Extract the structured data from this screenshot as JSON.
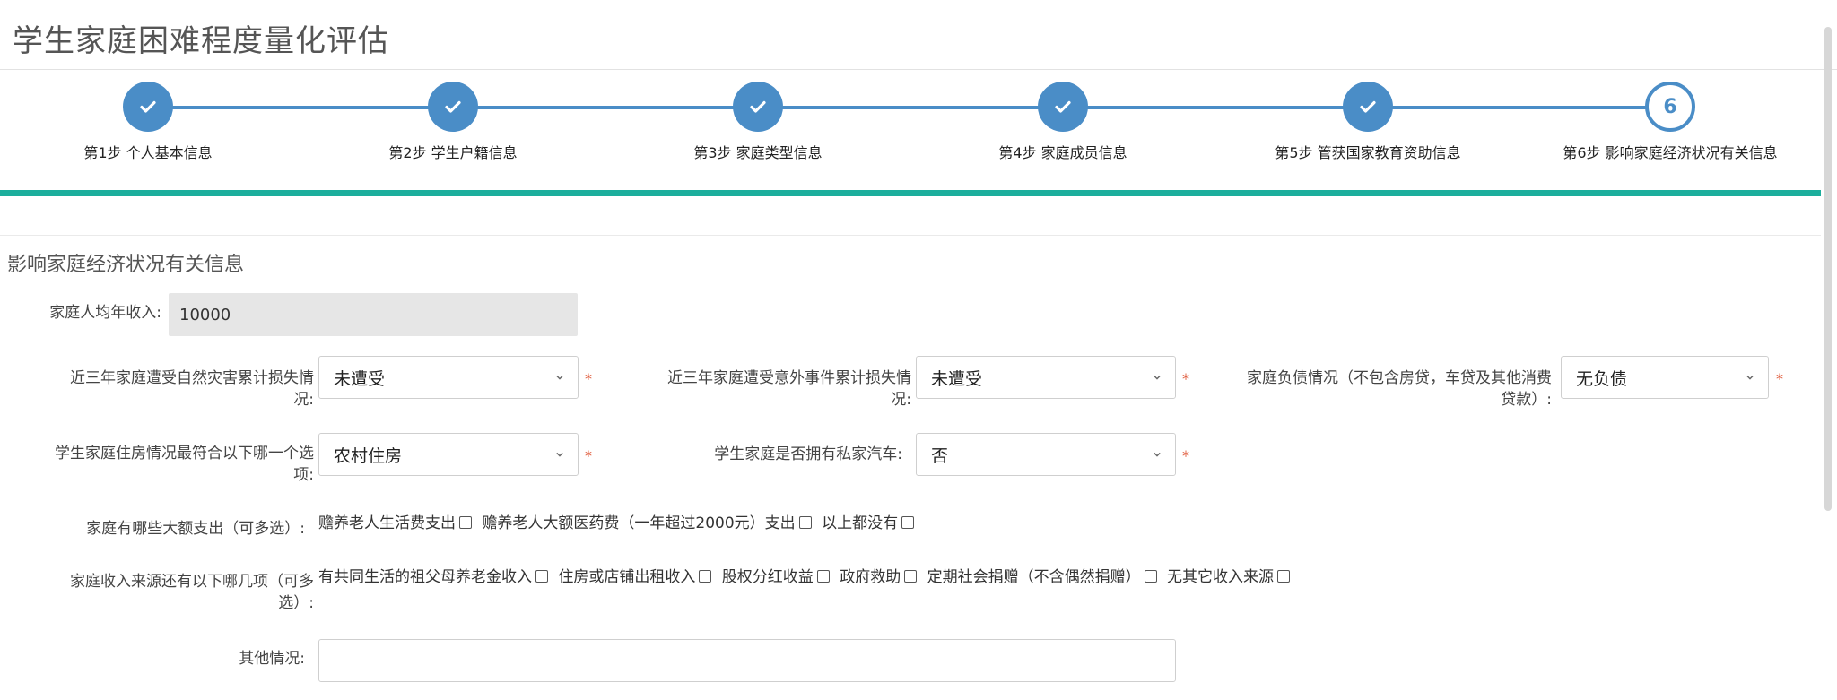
{
  "page": {
    "title": "学生家庭困难程度量化评估"
  },
  "steps": [
    {
      "label": "第1步 个人基本信息",
      "status": "done"
    },
    {
      "label": "第2步 学生户籍信息",
      "status": "done"
    },
    {
      "label": "第3步 家庭类型信息",
      "status": "done"
    },
    {
      "label": "第4步 家庭成员信息",
      "status": "done"
    },
    {
      "label": "第5步 管获国家教育资助信息",
      "status": "done"
    },
    {
      "label": "第6步 影响家庭经济状况有关信息",
      "status": "current",
      "number": "6"
    }
  ],
  "section": {
    "title": "影响家庭经济状况有关信息"
  },
  "form": {
    "income": {
      "label": "家庭人均年收入:",
      "value": "10000"
    },
    "disaster": {
      "label_line1": "近三年家庭遭受自然灾害累计损失情",
      "label_line2": "况:",
      "value": "未遭受"
    },
    "accident": {
      "label_line1": "近三年家庭遭受意外事件累计损失情",
      "label_line2": "况:",
      "value": "未遭受"
    },
    "debt": {
      "label_line1": "家庭负债情况（不包含房贷，车贷及其他消费",
      "label_line2": "贷款）:",
      "value": "无负债"
    },
    "housing": {
      "label_line1": "学生家庭住房情况最符合以下哪一个选",
      "label_line2": "项:",
      "value": "农村住房"
    },
    "car": {
      "label": "学生家庭是否拥有私家汽车:",
      "value": "否"
    },
    "expenses": {
      "label": "家庭有哪些大额支出（可多选）:",
      "options": [
        "赡养老人生活费支出",
        "赡养老人大额医药费（一年超过2000元）支出",
        "以上都没有"
      ]
    },
    "income_sources": {
      "label_line1": "家庭收入来源还有以下哪几项（可多",
      "label_line2": "选）:",
      "options": [
        "有共同生活的祖父母养老金收入",
        "住房或店铺出租收入",
        "股权分红收益",
        "政府救助",
        "定期社会捐赠（不含偶然捐赠）",
        "无其它收入来源"
      ]
    },
    "other": {
      "label": "其他情况:",
      "value": ""
    },
    "required_mark": "*"
  },
  "colors": {
    "accent": "#4a8dc7",
    "teal": "#1cae9c",
    "required": "#e05a3a"
  }
}
